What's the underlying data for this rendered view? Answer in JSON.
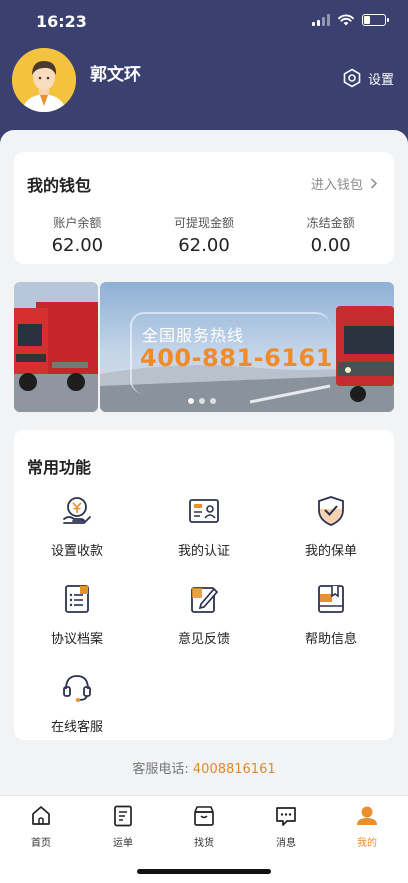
{
  "status_bar": {
    "time": "16:23"
  },
  "profile": {
    "name": "郭文环",
    "settings_label": "设置"
  },
  "wallet": {
    "title": "我的钱包",
    "link_label": "进入钱包",
    "items": [
      {
        "label": "账户余额",
        "value": "62.00"
      },
      {
        "label": "可提现金额",
        "value": "62.00"
      },
      {
        "label": "冻结金额",
        "value": "0.00"
      }
    ]
  },
  "banner": {
    "line1": "全国服务热线",
    "line2": "400-881-6161",
    "active_dot": 0,
    "dot_count": 3
  },
  "functions": {
    "title": "常用功能",
    "items": [
      {
        "label": "设置收款",
        "icon": "payment-settings-icon"
      },
      {
        "label": "我的认证",
        "icon": "id-card-icon"
      },
      {
        "label": "我的保单",
        "icon": "shield-check-icon"
      },
      {
        "label": "协议档案",
        "icon": "document-list-icon"
      },
      {
        "label": "意见反馈",
        "icon": "feedback-edit-icon"
      },
      {
        "label": "帮助信息",
        "icon": "help-book-icon"
      },
      {
        "label": "在线客服",
        "icon": "headset-icon"
      }
    ]
  },
  "hotline": {
    "label": "客服电话:",
    "number": "4008816161"
  },
  "tabbar": {
    "items": [
      {
        "label": "首页",
        "icon": "home-icon"
      },
      {
        "label": "运单",
        "icon": "waybill-icon"
      },
      {
        "label": "找货",
        "icon": "box-icon"
      },
      {
        "label": "消息",
        "icon": "message-icon"
      },
      {
        "label": "我的",
        "icon": "profile-icon",
        "active": true
      }
    ]
  },
  "colors": {
    "header_bg": "#3a4170",
    "accent": "#e8902d",
    "page_bg": "#f2f3f5"
  }
}
